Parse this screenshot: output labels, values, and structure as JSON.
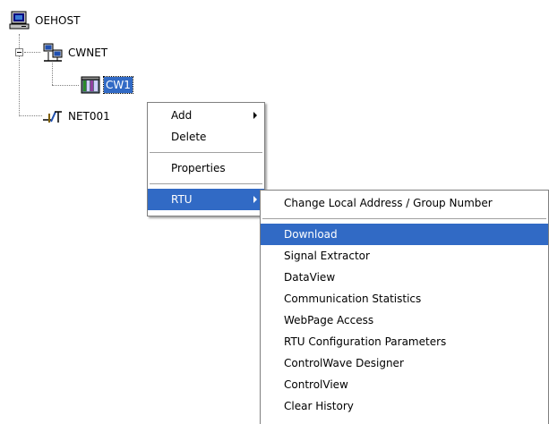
{
  "tree": {
    "root": {
      "label": "OEHOST",
      "icon": "computer-icon"
    },
    "network": {
      "label": "CWNET",
      "icon": "network-icon"
    },
    "rtu": {
      "label": "CW1",
      "icon": "rtu-icon"
    },
    "net001": {
      "label": "NET001",
      "icon": "connection-icon"
    }
  },
  "context_menu": {
    "items": [
      {
        "label": "Add",
        "has_submenu": true
      },
      {
        "label": "Delete"
      },
      {
        "label": "Properties"
      },
      {
        "label": "RTU",
        "has_submenu": true,
        "highlighted": true
      }
    ]
  },
  "rtu_submenu": {
    "items": [
      {
        "label": "Change Local Address / Group Number"
      },
      {
        "label": "Download",
        "highlighted": true
      },
      {
        "label": "Signal Extractor"
      },
      {
        "label": "DataView"
      },
      {
        "label": "Communication Statistics"
      },
      {
        "label": "WebPage Access"
      },
      {
        "label": "RTU Configuration Parameters"
      },
      {
        "label": "ControlWave Designer"
      },
      {
        "label": "ControlView"
      },
      {
        "label": "Clear History"
      }
    ]
  },
  "colors": {
    "selection": "#316ac5",
    "menu_border": "#808080"
  }
}
